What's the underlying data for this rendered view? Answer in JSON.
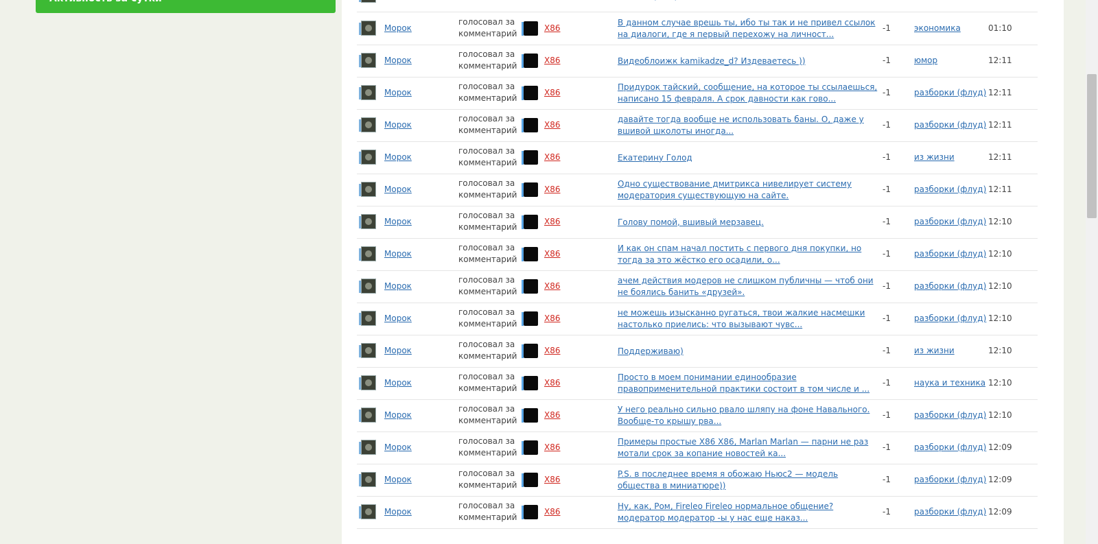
{
  "sidebar": {
    "activity_button": "Активность за сутки"
  },
  "top_row": {
    "comment": "может проверить. вот..."
  },
  "rows": [
    {
      "user": "Морок",
      "action": "голосовал за комментарий",
      "target": "X86",
      "comment": "В данном случае врешь ты, ибо ты так и не привел ссылок на диалоги, где я первый перехожу на личност...",
      "score": "-1",
      "category": "экономика",
      "time": "01:10"
    },
    {
      "user": "Морок",
      "action": "голосовал за комментарий",
      "target": "X86",
      "comment": "Видеоблоижк kamikadze_d? Издеваетесь ))",
      "score": "-1",
      "category": "юмор",
      "time": "12:11"
    },
    {
      "user": "Морок",
      "action": "голосовал за комментарий",
      "target": "X86",
      "comment": "Придурок тайский, сообщение, на которое ты ссылаешься, написано 15 февраля. А срок давности как гово...",
      "score": "-1",
      "category": "разборки (флуд)",
      "time": "12:11"
    },
    {
      "user": "Морок",
      "action": "голосовал за комментарий",
      "target": "X86",
      "comment": "давайте тогда вообще не использовать баны. О, даже у вшивой школоты иногда...",
      "score": "-1",
      "category": "разборки (флуд)",
      "time": "12:11"
    },
    {
      "user": "Морок",
      "action": "голосовал за комментарий",
      "target": "X86",
      "comment": "Екатерину Голод",
      "score": "-1",
      "category": "из жизни",
      "time": "12:11"
    },
    {
      "user": "Морок",
      "action": "голосовал за комментарий",
      "target": "X86",
      "comment": "Одно существование дмитрикса нивелирует систему модератория существующую на сайте.",
      "score": "-1",
      "category": "разборки (флуд)",
      "time": "12:11"
    },
    {
      "user": "Морок",
      "action": "голосовал за комментарий",
      "target": "X86",
      "comment": "Голову помой, вшивый мерзавец.",
      "score": "-1",
      "category": "разборки (флуд)",
      "time": "12:10"
    },
    {
      "user": "Морок",
      "action": "голосовал за комментарий",
      "target": "X86",
      "comment": "И как он спам начал постить с первого дня покупки, но тогда за это жёстко его осадили, о...",
      "score": "-1",
      "category": "разборки (флуд)",
      "time": "12:10"
    },
    {
      "user": "Морок",
      "action": "голосовал за комментарий",
      "target": "X86",
      "comment": "ачем действия модеров не слишком публичны — чтоб они не боялись банить «друзей».",
      "score": "-1",
      "category": "разборки (флуд)",
      "time": "12:10"
    },
    {
      "user": "Морок",
      "action": "голосовал за комментарий",
      "target": "X86",
      "comment": "не можешь изысканно ругаться, твои жалкие насмешки настолько приелись: что вызывают чувс...",
      "score": "-1",
      "category": "разборки (флуд)",
      "time": "12:10"
    },
    {
      "user": "Морок",
      "action": "голосовал за комментарий",
      "target": "X86",
      "comment": "Поддерживаю)",
      "score": "-1",
      "category": "из жизни",
      "time": "12:10"
    },
    {
      "user": "Морок",
      "action": "голосовал за комментарий",
      "target": "X86",
      "comment": "Просто в моем понимании единообразие правоприменительной практики состоит в том числе и ...",
      "score": "-1",
      "category": "наука и техника",
      "time": "12:10"
    },
    {
      "user": "Морок",
      "action": "голосовал за комментарий",
      "target": "X86",
      "comment": "У него реально сильно рвало шляпу на фоне Навального. Вообще-то крышу рва...",
      "score": "-1",
      "category": "разборки (флуд)",
      "time": "12:10"
    },
    {
      "user": "Морок",
      "action": "голосовал за комментарий",
      "target": "X86",
      "comment": "Примеры простые X86 X86, Marlan Marlan — парни не раз мотали срок за копание новостей ка...",
      "score": "-1",
      "category": "разборки (флуд)",
      "time": "12:09"
    },
    {
      "user": "Морок",
      "action": "голосовал за комментарий",
      "target": "X86",
      "comment": "P.S. в последнее время я обожаю Ньюс2 — модель общества в миниатюре))",
      "score": "-1",
      "category": "разборки (флуд)",
      "time": "12:09"
    },
    {
      "user": "Морок",
      "action": "голосовал за комментарий",
      "target": "X86",
      "comment": "Ну, как, Ром, Fireleo Fireleo нормальное общение? модератор модератор -ы у нас еще наказ...",
      "score": "-1",
      "category": "разборки (флуд)",
      "time": "12:09"
    }
  ]
}
